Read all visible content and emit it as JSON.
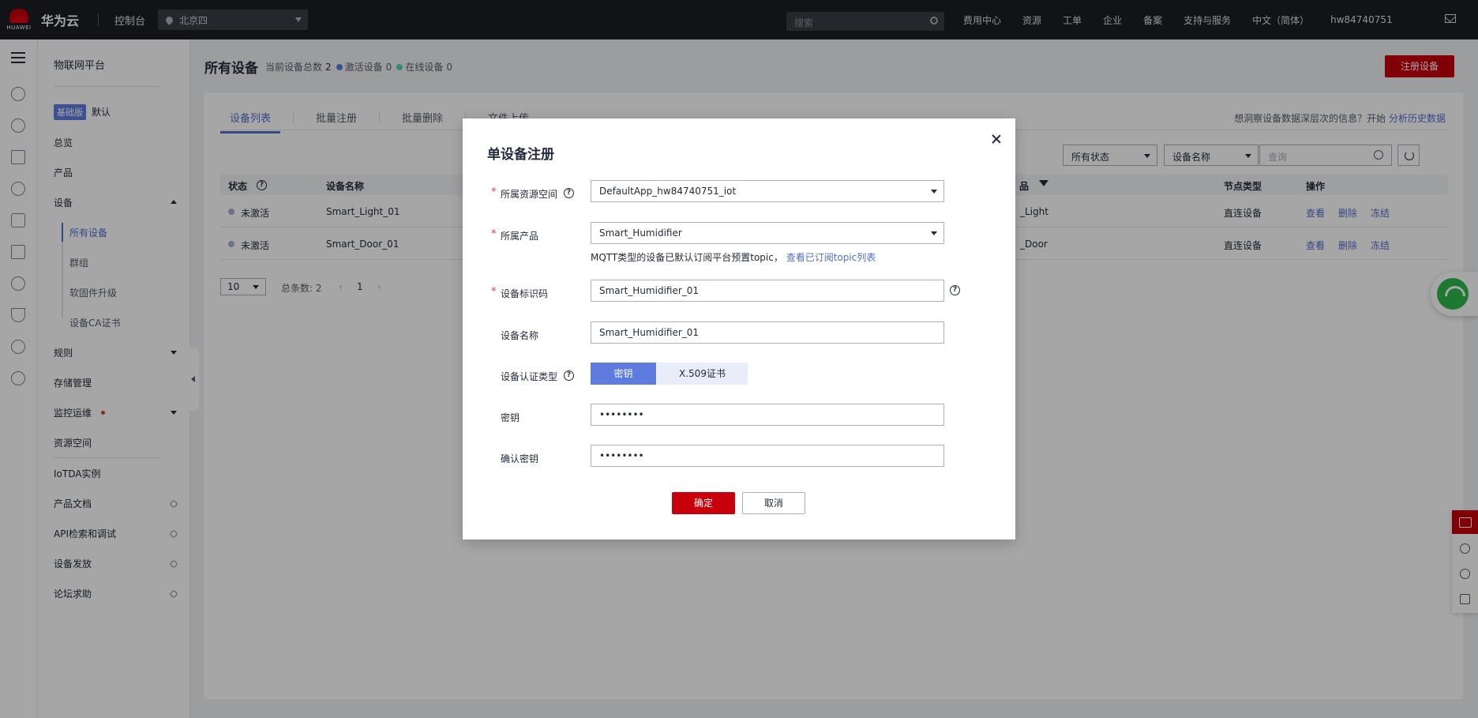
{
  "topbar": {
    "brand": "华为云",
    "logo_text": "HUAWEI",
    "console": "控制台",
    "region": "北京四",
    "search_placeholder": "搜索",
    "nav": [
      "费用中心",
      "资源",
      "工单",
      "企业",
      "备案",
      "支持与服务",
      "中文（简体）",
      "hw84740751"
    ]
  },
  "sidebar": {
    "title": "物联网平台",
    "edition_badge": "基础版",
    "edition_name": "默认",
    "items": {
      "overview": "总览",
      "product": "产品",
      "device": "设备",
      "all_devices": "所有设备",
      "groups": "群组",
      "firmware": "软固件升级",
      "ca_cert": "设备CA证书",
      "rules": "规则",
      "storage": "存储管理",
      "monitor": "监控运维",
      "resource_space": "资源空间",
      "iotda_instance": "IoTDA实例",
      "product_docs": "产品文档",
      "api": "API检索和调试",
      "provisioning": "设备发放",
      "forum": "论坛求助"
    }
  },
  "page": {
    "title": "所有设备",
    "total_label": "当前设备总数",
    "total_value": "2",
    "active_label": "激活设备",
    "active_value": "0",
    "online_label": "在线设备",
    "online_value": "0",
    "register_button": "注册设备",
    "colors": {
      "active_dot": "#5e7ce0",
      "online_dot": "#50d4ab",
      "brand_red": "#c7000b"
    }
  },
  "tabs": [
    "设备列表",
    "批量注册",
    "批量删除",
    "文件上传"
  ],
  "hint": {
    "text": "想洞察设备数据深层次的信息？开始",
    "link": "分析历史数据"
  },
  "filters": {
    "status": "所有状态",
    "field": "设备名称",
    "search_placeholder": "查询"
  },
  "table": {
    "headers": {
      "status": "状态",
      "name": "设备名称",
      "product": "品",
      "node_type": "节点类型",
      "ops": "操作"
    },
    "rows": [
      {
        "status": "未激活",
        "name": "Smart_Light_01",
        "product": "_Light",
        "node_type": "直连设备"
      },
      {
        "status": "未激活",
        "name": "Smart_Door_01",
        "product": "_Door",
        "node_type": "直连设备"
      }
    ],
    "ops": {
      "view": "查看",
      "delete": "删除",
      "freeze": "冻结"
    }
  },
  "pager": {
    "page_size": "10",
    "total": "总条数: 2",
    "current": "1",
    "prev": "‹",
    "next": "›"
  },
  "dialog": {
    "title": "单设备注册",
    "resource_space": {
      "label": "所属资源空间",
      "value": "DefaultApp_hw84740751_iot"
    },
    "product": {
      "label": "所属产品",
      "value": "Smart_Humidifier"
    },
    "note": "MQTT类型的设备已默认订阅平台预置topic，",
    "note_link": "查看已订阅topic列表",
    "device_id": {
      "label": "设备标识码",
      "value": "Smart_Humidifier_01"
    },
    "device_name": {
      "label": "设备名称",
      "value": "Smart_Humidifier_01"
    },
    "auth_type": {
      "label": "设备认证类型",
      "options": [
        "密钥",
        "X.509证书"
      ],
      "selected": "密钥"
    },
    "secret": {
      "label": "密钥",
      "value": "••••••••"
    },
    "confirm_secret": {
      "label": "确认密钥",
      "value": "••••••••"
    },
    "ok": "确定",
    "cancel": "取消",
    "required_mark": "*",
    "help_mark": "?"
  }
}
